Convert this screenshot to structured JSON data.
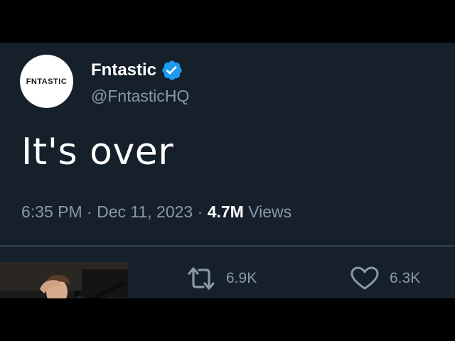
{
  "tweet": {
    "avatar_text": "FNTASTIC",
    "display_name": "Fntastic",
    "handle": "@FntasticHQ",
    "text": "It's over",
    "time": "6:35 PM",
    "separator": "·",
    "date": "Dec 11, 2023",
    "views_count": "4.7M",
    "views_label": "Views",
    "retweets": "6.9K",
    "likes": "6.3K",
    "verified_icon": "verified-badge-icon",
    "retweet_icon": "retweet-icon",
    "like_icon": "heart-icon"
  },
  "colors": {
    "background": "#15202b",
    "verified": "#1d9bf0",
    "secondary_text": "#8b98a5",
    "divider": "#38444d"
  }
}
